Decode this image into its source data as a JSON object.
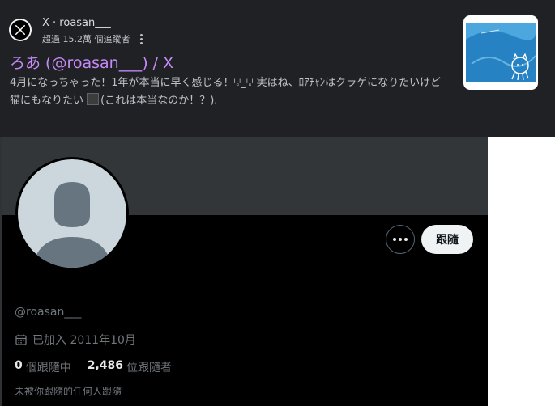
{
  "search_result": {
    "site_name": "X · roasan___",
    "meta": "超過 15.2萬 個追蹤者",
    "title": "ろあ (@roasan___) / X",
    "snippet_main": "4月になっちゃった！1年が本当に早く感じる！ᵎ𝅆ᵎ_ᵎ𝅆ᵎ 実はね、ﾛｱﾁｬﾝはクラゲになりたいけど猫にもなりたい",
    "snippet_tail": "(これは本当なのか！？).",
    "thumbnail_alt": "jellyfish cat drawing"
  },
  "profile": {
    "handle": "@roasan___",
    "joined": "已加入 2011年10月",
    "following_count": "0",
    "following_label": "個跟隨中",
    "followers_count": "2,486",
    "followers_label": "位跟隨者",
    "not_followed_note": "未被你跟隨的任何人跟隨",
    "follow_label": "跟隨"
  },
  "colors": {
    "title_link": "#c58af9",
    "banner": "#333639",
    "avatar_placeholder": "#ccd6dd"
  }
}
